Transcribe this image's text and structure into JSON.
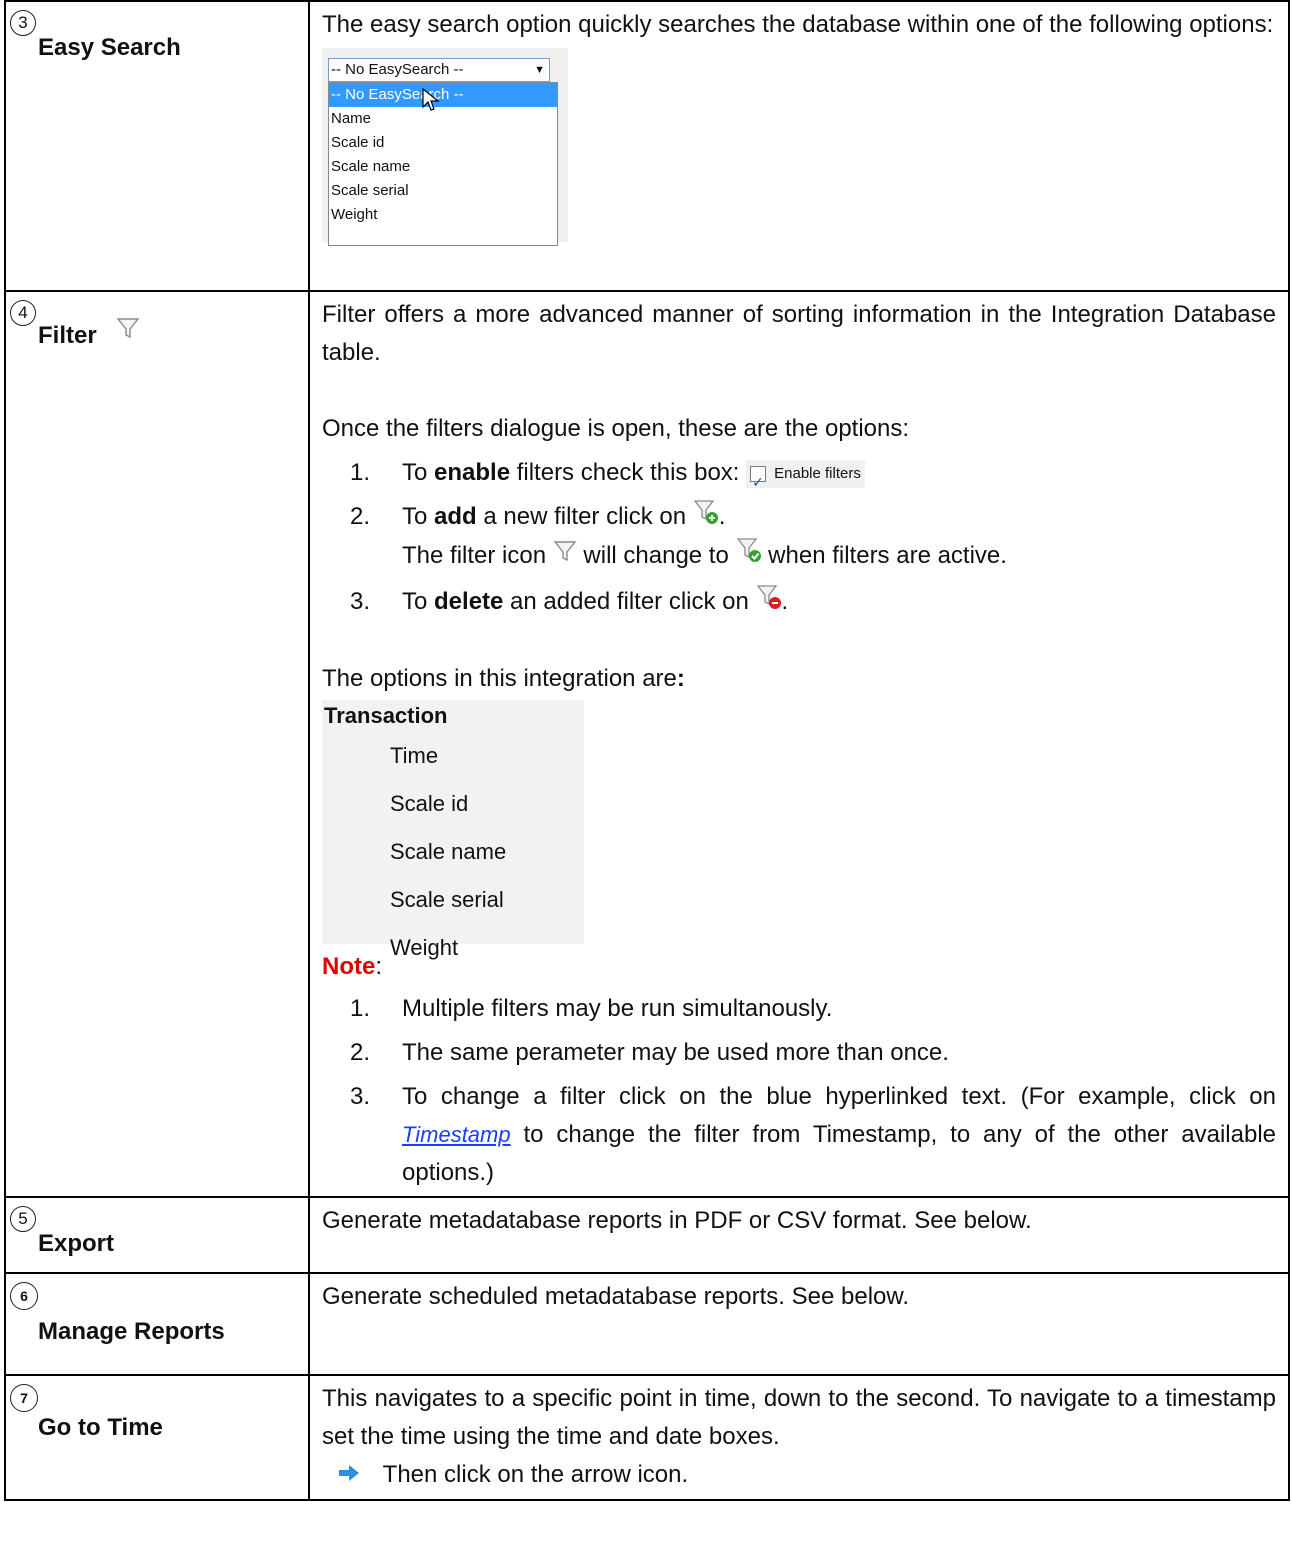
{
  "rows": {
    "easy_search": {
      "num": "3",
      "label": "Easy Search",
      "desc": "The easy search option quickly searches the database within one of the following options:",
      "dropdown": {
        "selected": "-- No EasySearch --",
        "options": [
          "-- No EasySearch --",
          "Name",
          "Scale id",
          "Scale name",
          "Scale serial",
          "Weight"
        ]
      }
    },
    "filter": {
      "num": "4",
      "label": "Filter",
      "desc": "Filter offers a more advanced manner of sorting information in the Integration Database table.",
      "intro": "Once the filters dialogue is open, these are the options:",
      "steps": {
        "s1_pre": "To ",
        "s1_bold": "enable",
        "s1_post": " filters check this box:",
        "s1_checkbox_label": "Enable filters",
        "s2_pre": "To ",
        "s2_bold": "add",
        "s2_post": " a new filter click on",
        "s2_line2_pre": "The filter icon",
        "s2_line2_mid": "will change to",
        "s2_line2_post": "when filters are active.",
        "s3_pre": "To ",
        "s3_bold": "delete",
        "s3_post": " an added filter click on"
      },
      "options_intro": "The options in this integration are",
      "tree": {
        "root": "Transaction",
        "items": [
          "Time",
          "Scale id",
          "Scale name",
          "Scale serial",
          "Weight"
        ]
      },
      "note_label": "Note",
      "notes": [
        "Multiple filters may be run simultanously.",
        "The same perameter may be used more than once.",
        " To change a filter click on the blue hyperlinked text. (For example, click on"
      ],
      "note3_link": "Timestamp",
      "note3_tail": "to change the filter from Timestamp, to any of the other available options.)"
    },
    "export": {
      "num": "5",
      "label": "Export",
      "desc": "Generate metadatabase reports in PDF or CSV format. See below."
    },
    "manage_reports": {
      "num": "6",
      "label": "Manage Reports",
      "desc": "Generate scheduled metadatabase reports. See below."
    },
    "go_to_time": {
      "num": "7",
      "label": "Go to Time",
      "desc": "This navigates to a specific point in time, down to the second. To navigate to a timestamp set the time using the time and date boxes.",
      "arrow_text": "Then click on the arrow icon."
    }
  },
  "colors": {
    "note": "#e00000",
    "link": "#1a3cff",
    "arrow": "#2f8de4"
  }
}
